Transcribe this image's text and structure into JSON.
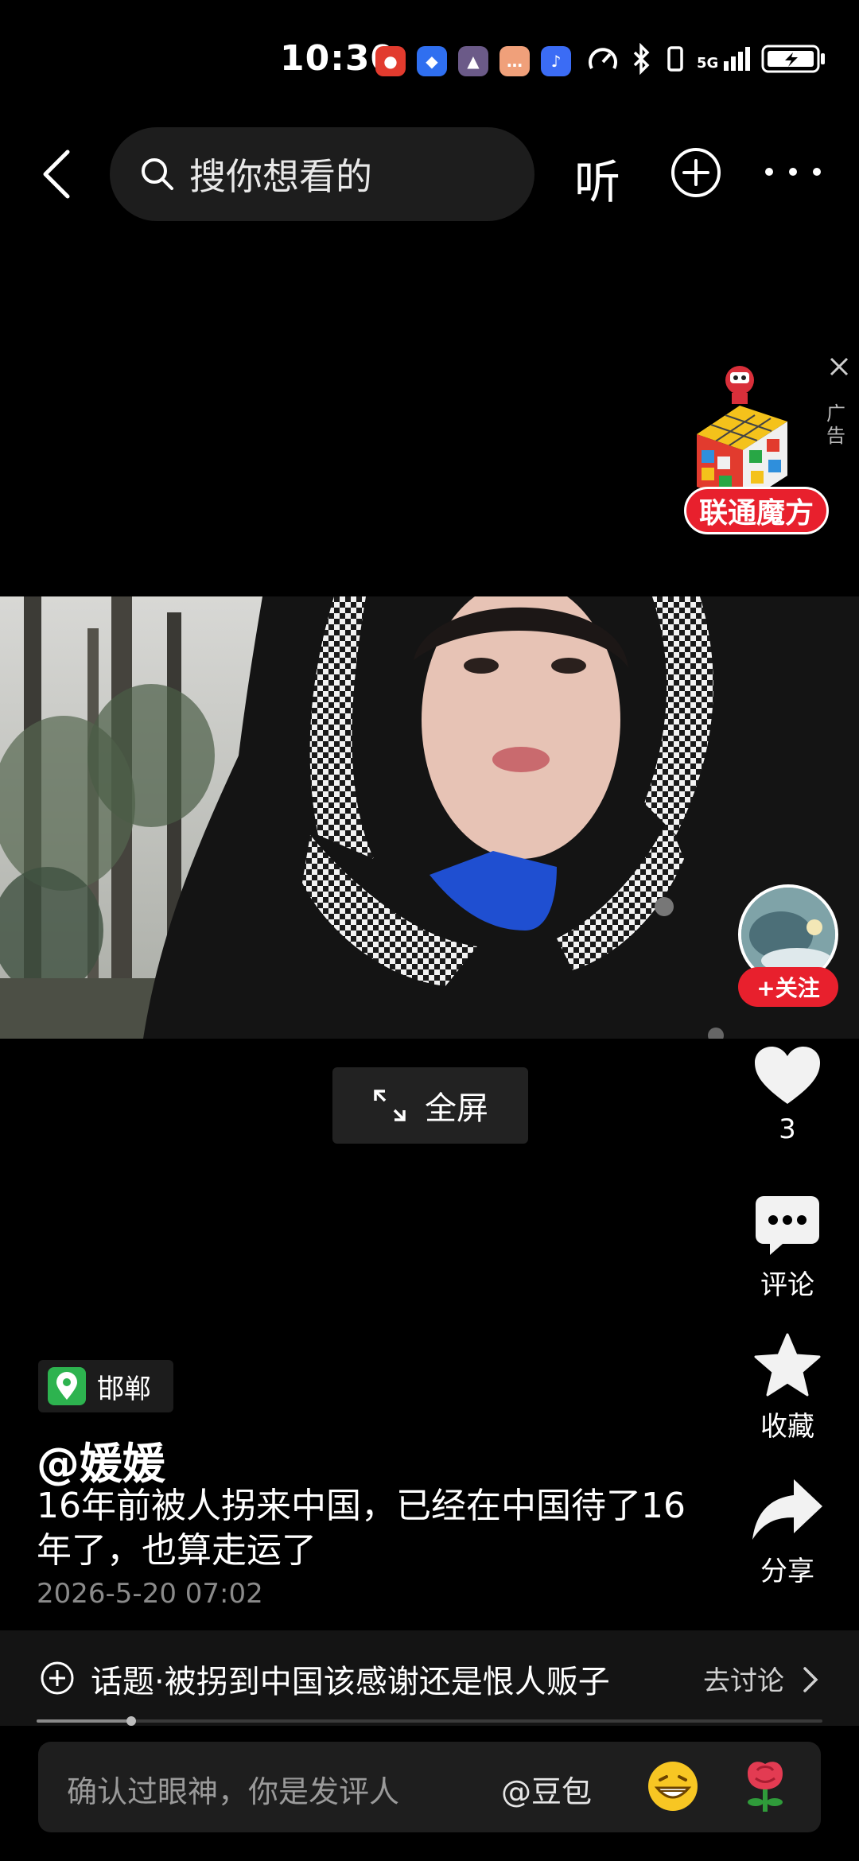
{
  "status_bar": {
    "time": "10:30",
    "network": "5G",
    "app_icons": [
      "jd-icon",
      "baidu-icon",
      "game-icon",
      "chat-icon",
      "music-icon"
    ]
  },
  "top_nav": {
    "search_placeholder": "搜你想看的",
    "listen_label": "听"
  },
  "ad": {
    "label": "联通魔方",
    "tag": "广告"
  },
  "fullscreen": {
    "label": "全屏"
  },
  "author": {
    "follow_label": "+关注",
    "name": "@媛媛"
  },
  "actions": {
    "like_count": "3",
    "comment_label": "评论",
    "favorite_label": "收藏",
    "share_label": "分享"
  },
  "post": {
    "location": "邯郸",
    "caption": "16年前被人拐来中国，已经在中国待了16年了，也算走运了",
    "time": "2026-5-20 07:02"
  },
  "topic": {
    "text": "话题·被拐到中国该感谢还是恨人贩子",
    "link_label": "去讨论"
  },
  "progress": {
    "fraction": 0.12
  },
  "comment_bar": {
    "placeholder": "确认过眼神，你是发评人",
    "mention": "@豆包"
  },
  "colors": {
    "accent_red": "#e8202d",
    "location_green": "#2db34f",
    "background": "#000000"
  }
}
